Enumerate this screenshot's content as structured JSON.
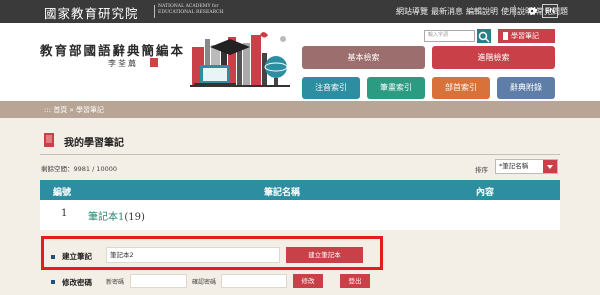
{
  "topbar": {
    "logo_zh": "國家教育研究院",
    "logo_en_line1": "NATIONAL ACADEMY for",
    "logo_en_line2": "EDUCATIONAL RESEARCH",
    "nav": [
      "網站導覽",
      "最新消息",
      "編輯說明",
      "使用說明",
      "常見問題"
    ],
    "lang": "EN"
  },
  "header": {
    "site_title": "教育部國語辭典簡編本",
    "calligrapher": "李荃萹",
    "search_placeholder": "輸入字詞",
    "notebook_button": "學習筆記",
    "basic_search": "基本檢索",
    "advanced_search": "進階檢索",
    "index_buttons": [
      "注音索引",
      "筆畫索引",
      "部首索引",
      "辭典附錄"
    ]
  },
  "breadcrumb": {
    "prefix": "::: ",
    "home": "首頁",
    "sep": " » ",
    "current": "學習筆記"
  },
  "page": {
    "title": "我的學習筆記",
    "storage": "剩餘空間：9981 / 10000",
    "sort_label": "排序",
    "sort_value": "*筆記名稱"
  },
  "table": {
    "headers": [
      "編號",
      "筆記名稱",
      "內容"
    ],
    "rows": [
      {
        "num": "1",
        "name": "筆記本1",
        "count": "(19)"
      }
    ]
  },
  "create": {
    "label": "建立筆記",
    "value": "筆記本2",
    "button": "建立筆記本"
  },
  "password": {
    "label": "修改密碼",
    "new_label": "新密碼",
    "confirm_label": "確認密碼",
    "change_button": "修改",
    "logout_button": "登出"
  },
  "colors": {
    "accent_red": "#c94048",
    "teal": "#2c8ea0",
    "highlight_box": "#e11d1d"
  }
}
